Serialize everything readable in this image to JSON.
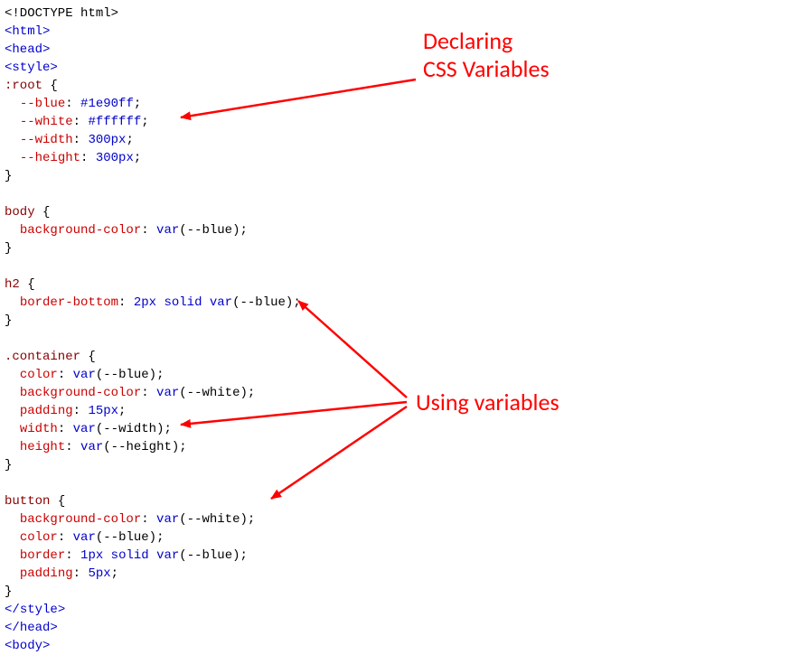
{
  "code": {
    "l1": "<!DOCTYPE html>",
    "l2_open": "<",
    "l2_tag": "html",
    "l2_close": ">",
    "l3_open": "<",
    "l3_tag": "head",
    "l3_close": ">",
    "l4_open": "<",
    "l4_tag": "style",
    "l4_close": ">",
    "l5_sel": ":root",
    "l5_brace": " {",
    "l6_prop": "--blue",
    "l6_colon": ": ",
    "l6_val": "#1e90ff",
    "l6_semi": ";",
    "l7_prop": "--white",
    "l7_colon": ": ",
    "l7_val": "#ffffff",
    "l7_semi": ";",
    "l8_prop": "--width",
    "l8_colon": ": ",
    "l8_val": "300px",
    "l8_semi": ";",
    "l9_prop": "--height",
    "l9_colon": ": ",
    "l9_val": "300px",
    "l9_semi": ";",
    "l10_brace": "}",
    "l12_sel": "body",
    "l12_brace": " {",
    "l13_prop": "background-color",
    "l13_colon": ": ",
    "l13_fn": "var",
    "l13_arg": "(--blue)",
    "l13_semi": ";",
    "l14_brace": "}",
    "l16_sel": "h2",
    "l16_brace": " {",
    "l17_prop": "border-bottom",
    "l17_colon": ": ",
    "l17_v1": "2px",
    "l17_v2": " solid ",
    "l17_fn": "var",
    "l17_arg": "(--blue)",
    "l17_semi": ";",
    "l18_brace": "}",
    "l20_sel": ".container",
    "l20_brace": " {",
    "l21_prop": "color",
    "l21_colon": ": ",
    "l21_fn": "var",
    "l21_arg": "(--blue)",
    "l21_semi": ";",
    "l22_prop": "background-color",
    "l22_colon": ": ",
    "l22_fn": "var",
    "l22_arg": "(--white)",
    "l22_semi": ";",
    "l23_prop": "padding",
    "l23_colon": ": ",
    "l23_val": "15px",
    "l23_semi": ";",
    "l24_prop": "width",
    "l24_colon": ": ",
    "l24_fn": "var",
    "l24_arg": "(--width)",
    "l24_semi": ";",
    "l25_prop": "height",
    "l25_colon": ": ",
    "l25_fn": "var",
    "l25_arg": "(--height)",
    "l25_semi": ";",
    "l26_brace": "}",
    "l28_sel": "button",
    "l28_brace": " {",
    "l29_prop": "background-color",
    "l29_colon": ": ",
    "l29_fn": "var",
    "l29_arg": "(--white)",
    "l29_semi": ";",
    "l30_prop": "color",
    "l30_colon": ": ",
    "l30_fn": "var",
    "l30_arg": "(--blue)",
    "l30_semi": ";",
    "l31_prop": "border",
    "l31_colon": ": ",
    "l31_v1": "1px",
    "l31_v2": " solid ",
    "l31_fn": "var",
    "l31_arg": "(--blue)",
    "l31_semi": ";",
    "l32_prop": "padding",
    "l32_colon": ": ",
    "l32_val": "5px",
    "l32_semi": ";",
    "l33_brace": "}",
    "l34_open": "</",
    "l34_tag": "style",
    "l34_close": ">",
    "l35_open": "</",
    "l35_tag": "head",
    "l35_close": ">",
    "l36_open": "<",
    "l36_tag": "body",
    "l36_close": ">"
  },
  "annotations": {
    "declaring_line1": "Declaring",
    "declaring_line2": "CSS Variables",
    "using": "Using variables"
  }
}
